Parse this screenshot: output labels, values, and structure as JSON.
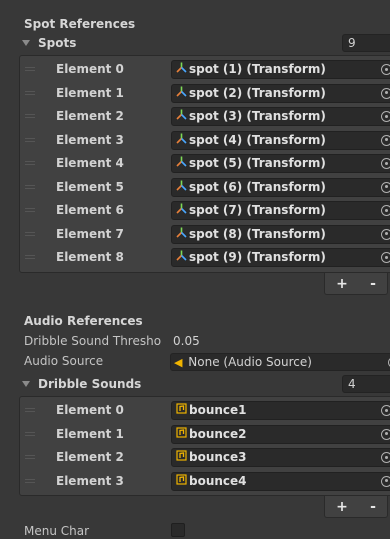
{
  "spot_section": {
    "header": "Spot References",
    "list_label": "Spots",
    "count": "9",
    "items": [
      {
        "label": "Element 0",
        "value": "spot (1) (Transform)"
      },
      {
        "label": "Element 1",
        "value": "spot (2) (Transform)"
      },
      {
        "label": "Element 2",
        "value": "spot (3) (Transform)"
      },
      {
        "label": "Element 3",
        "value": "spot (4) (Transform)"
      },
      {
        "label": "Element 4",
        "value": "spot (5) (Transform)"
      },
      {
        "label": "Element 5",
        "value": "spot (6) (Transform)"
      },
      {
        "label": "Element 6",
        "value": "spot (7) (Transform)"
      },
      {
        "label": "Element 7",
        "value": "spot (8) (Transform)"
      },
      {
        "label": "Element 8",
        "value": "spot (9) (Transform)"
      }
    ],
    "add_label": "+",
    "remove_label": "-"
  },
  "audio_section": {
    "header": "Audio References",
    "threshold_label": "Dribble Sound Thresho",
    "threshold_value": "0.05",
    "audio_source_label": "Audio Source",
    "audio_source_value": "None (Audio Source)",
    "list_label": "Dribble Sounds",
    "count": "4",
    "items": [
      {
        "label": "Element 0",
        "value": "bounce1"
      },
      {
        "label": "Element 1",
        "value": "bounce2"
      },
      {
        "label": "Element 2",
        "value": "bounce3"
      },
      {
        "label": "Element 3",
        "value": "bounce4"
      }
    ],
    "add_label": "+",
    "remove_label": "-"
  },
  "menu_char": {
    "label": "Menu Char",
    "checked": false
  },
  "icons": {
    "transform": "transform-icon",
    "audio_source": "audio-source-icon",
    "audio_clip": "audio-clip-icon",
    "object_picker": "object-picker-icon"
  },
  "colors": {
    "background": "#383838",
    "field": "#2a2a2a",
    "list_background": "#414141",
    "audio_clip_icon": "#f0b400",
    "audio_source_icon": "#f0b400"
  }
}
